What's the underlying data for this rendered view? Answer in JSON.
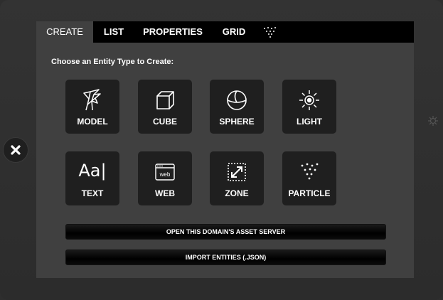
{
  "tabs": [
    {
      "label": "CREATE",
      "active": true
    },
    {
      "label": "LIST",
      "active": false
    },
    {
      "label": "PROPERTIES",
      "active": false
    },
    {
      "label": "GRID",
      "active": false
    }
  ],
  "tab_icon": "particle-icon",
  "heading": "Choose an Entity Type to Create:",
  "tiles": [
    {
      "label": "MODEL",
      "icon": "model-icon"
    },
    {
      "label": "CUBE",
      "icon": "cube-icon"
    },
    {
      "label": "SPHERE",
      "icon": "sphere-icon"
    },
    {
      "label": "LIGHT",
      "icon": "light-icon"
    },
    {
      "label": "TEXT",
      "icon": "text-icon",
      "glyph": "Aa|"
    },
    {
      "label": "WEB",
      "icon": "web-icon",
      "glyph": "web"
    },
    {
      "label": "ZONE",
      "icon": "zone-icon"
    },
    {
      "label": "PARTICLE",
      "icon": "particle-icon"
    }
  ],
  "buttons": {
    "asset_server": "OPEN THIS DOMAIN'S ASSET SERVER",
    "import": "IMPORT ENTITIES (.JSON)"
  },
  "colors": {
    "panel": "#404040",
    "tabbar": "#000000",
    "tile": "#1f1f1f",
    "text": "#ffffff"
  }
}
